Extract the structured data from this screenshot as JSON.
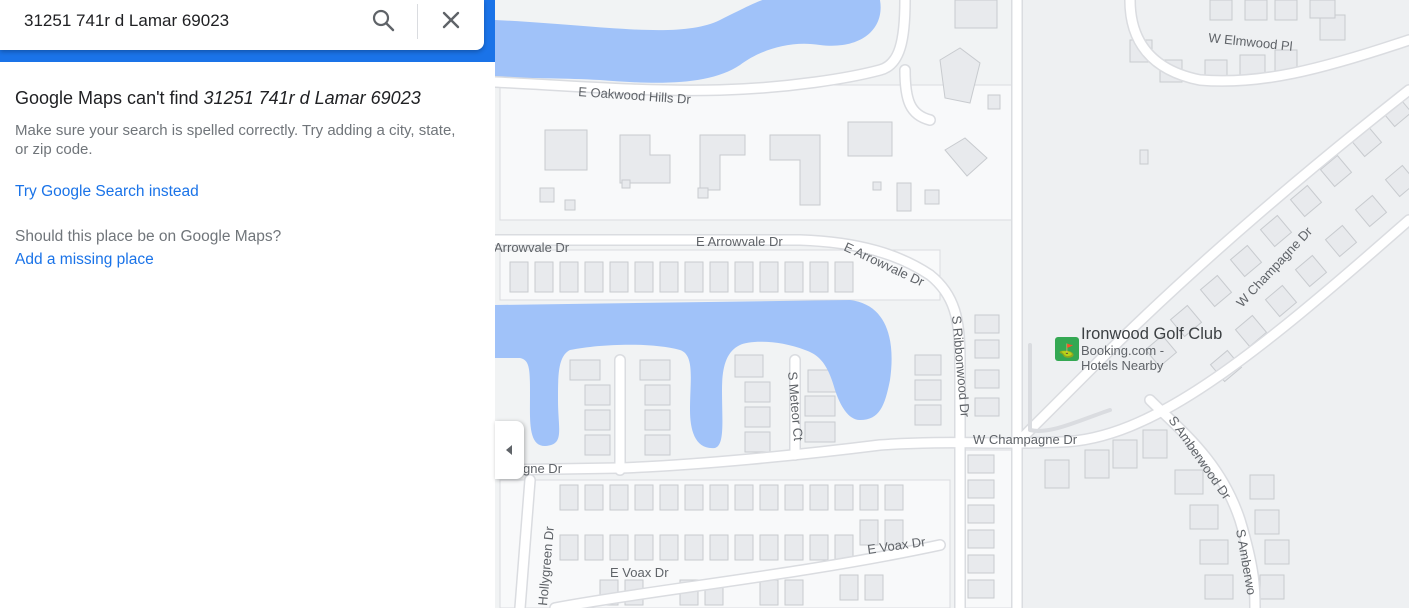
{
  "search": {
    "query": "31251 741r d Lamar 69023"
  },
  "panel": {
    "not_found_prefix": "Google Maps can't find ",
    "not_found_query": "31251 741r d Lamar 69023",
    "hint": "Make sure your search is spelled correctly. Try adding a city, state, or zip code.",
    "google_search_link": "Try Google Search instead",
    "question": "Should this place be on Google Maps?",
    "add_place_link": "Add a missing place"
  },
  "map": {
    "streets": {
      "w_elmwood_pl": "W Elmwood Pl",
      "e_oakwood_hills_dr": "E Oakwood Hills Dr",
      "arrowvale_dr": "Arrowvale Dr",
      "e_arrowvale_dr_1": "E Arrowvale Dr",
      "e_arrowvale_dr_2": "E Arrowvale Dr",
      "s_ribbonwood_dr": "S Ribbonwood Dr",
      "s_meteor_ct": "S Meteor Ct",
      "w_champagne_dr_1": "W Champagne Dr",
      "w_champagne_dr_2": "W Champagne Dr",
      "gne_dr": "gne Dr",
      "s_amberwood_dr": "S Amberwood Dr",
      "s_amberwood_2": "S Amberwo",
      "hollygreen_dr": "Hollygreen Dr",
      "e_voax_dr_1": "E Voax Dr",
      "e_voax_dr_2": "E Voax Dr"
    },
    "poi": {
      "name": "Ironwood Golf Club",
      "sub_line1": "Booking.com -",
      "sub_line2": "Hotels Nearby",
      "icon": "golf-icon"
    }
  },
  "colors": {
    "water": "#a0c2f9",
    "map_bg": "#f1f3f4",
    "road": "#ffffff",
    "road_outline": "#dadce0",
    "link": "#1a73e8",
    "poi_green": "#34a853"
  }
}
